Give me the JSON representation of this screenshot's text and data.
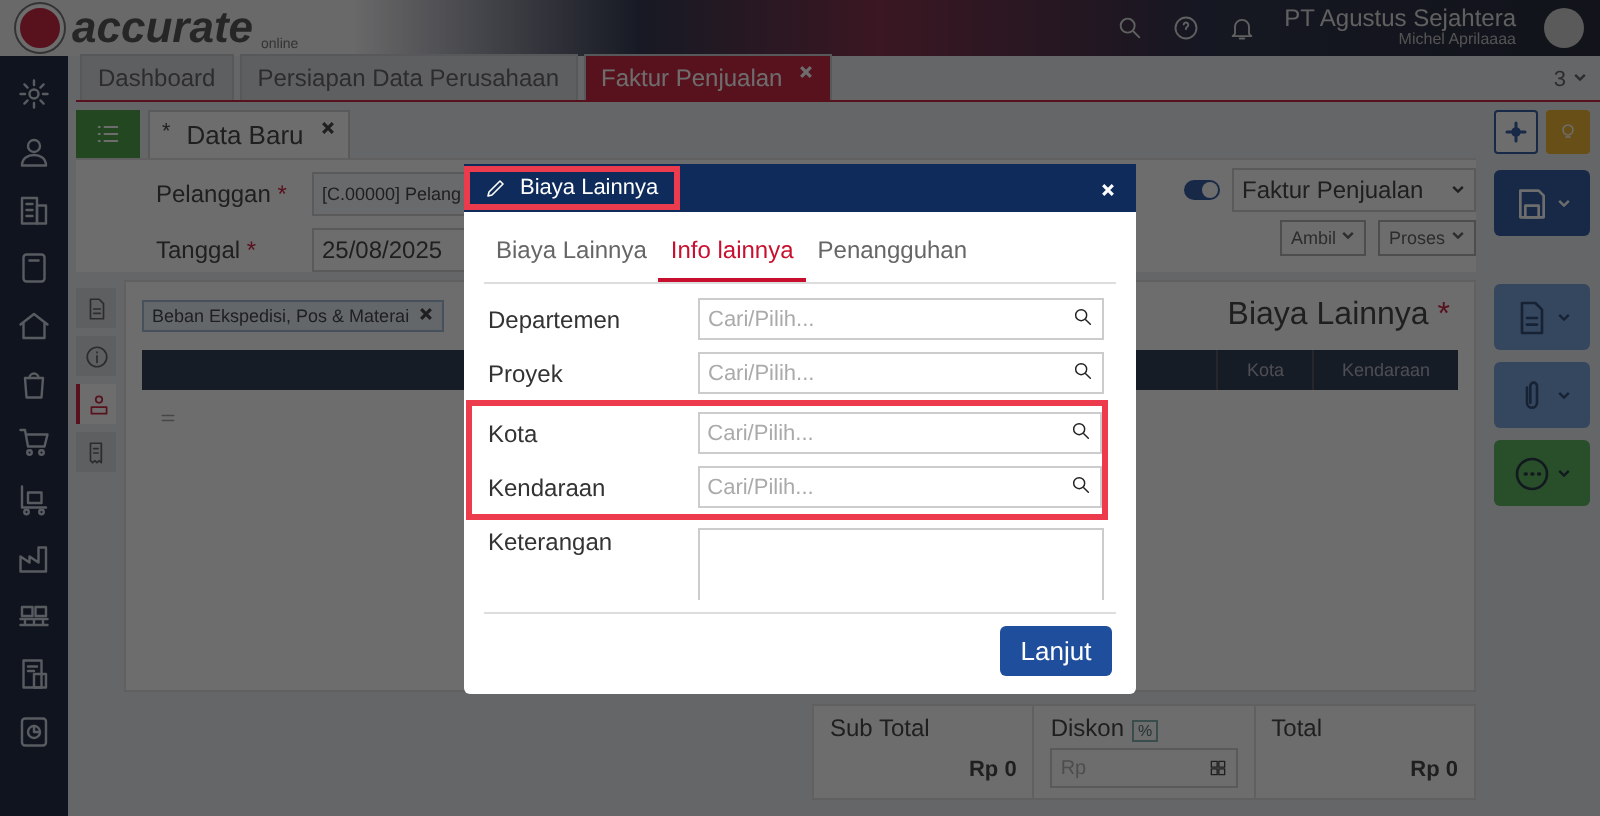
{
  "header": {
    "logo": "accurate",
    "logo_sub": "online",
    "company": "PT Agustus Sejahtera",
    "user": "Michel Aprilaaaa"
  },
  "tabs": [
    {
      "label": "Dashboard",
      "selected": false,
      "closable": false
    },
    {
      "label": "Persiapan Data Perusahaan",
      "selected": false,
      "closable": false
    },
    {
      "label": "Faktur Penjualan",
      "selected": true,
      "closable": true
    }
  ],
  "tab_overflow": "3",
  "doc_tab": {
    "label": "Data Baru",
    "modified_mark": "*"
  },
  "form": {
    "fields": [
      {
        "label": "Pelanggan",
        "required_mark": "*",
        "value": "[C.00000] Pelang"
      },
      {
        "label": "Tanggal",
        "required_mark": "*",
        "value": "25/08/2025"
      }
    ],
    "toggle_on": true,
    "type_value": "Faktur Penjualan",
    "buttons": [
      "Ambil",
      "Proses"
    ]
  },
  "detail": {
    "side_tabs": [
      {
        "kind": "document",
        "selected": false
      },
      {
        "kind": "info",
        "selected": false
      },
      {
        "kind": "cost",
        "selected": true
      },
      {
        "kind": "receipt",
        "selected": false
      }
    ],
    "chip": "Beban Ekspedisi, Pos & Materai",
    "title": "Biaya Lainnya",
    "title_mark": "*",
    "columns": [
      "Kota",
      "Kendaraan"
    ]
  },
  "totals": [
    {
      "kind": "amount",
      "label": "Sub Total",
      "value": "Rp 0"
    },
    {
      "kind": "discount",
      "label": "Diskon",
      "badge": "%",
      "placeholder": "Rp"
    },
    {
      "kind": "amount",
      "label": "Total",
      "value": "Rp 0"
    }
  ],
  "modal": {
    "title": "Biaya Lainnya",
    "title_highlighted": true,
    "tabs": [
      {
        "label": "Biaya Lainnya",
        "selected": false
      },
      {
        "label": "Info lainnya",
        "selected": true
      },
      {
        "label": "Penangguhan",
        "selected": false
      }
    ],
    "fields": [
      {
        "kind": "lookup",
        "label": "Departemen",
        "placeholder": "Cari/Pilih...",
        "highlighted": false
      },
      {
        "kind": "lookup",
        "label": "Proyek",
        "placeholder": "Cari/Pilih...",
        "highlighted": false
      },
      {
        "kind": "lookup",
        "label": "Kota",
        "placeholder": "Cari/Pilih...",
        "highlighted": true
      },
      {
        "kind": "lookup",
        "label": "Kendaraan",
        "placeholder": "Cari/Pilih...",
        "highlighted": true
      },
      {
        "kind": "textarea",
        "label": "Keterangan",
        "highlighted": false
      }
    ],
    "button": "Lanjut"
  }
}
